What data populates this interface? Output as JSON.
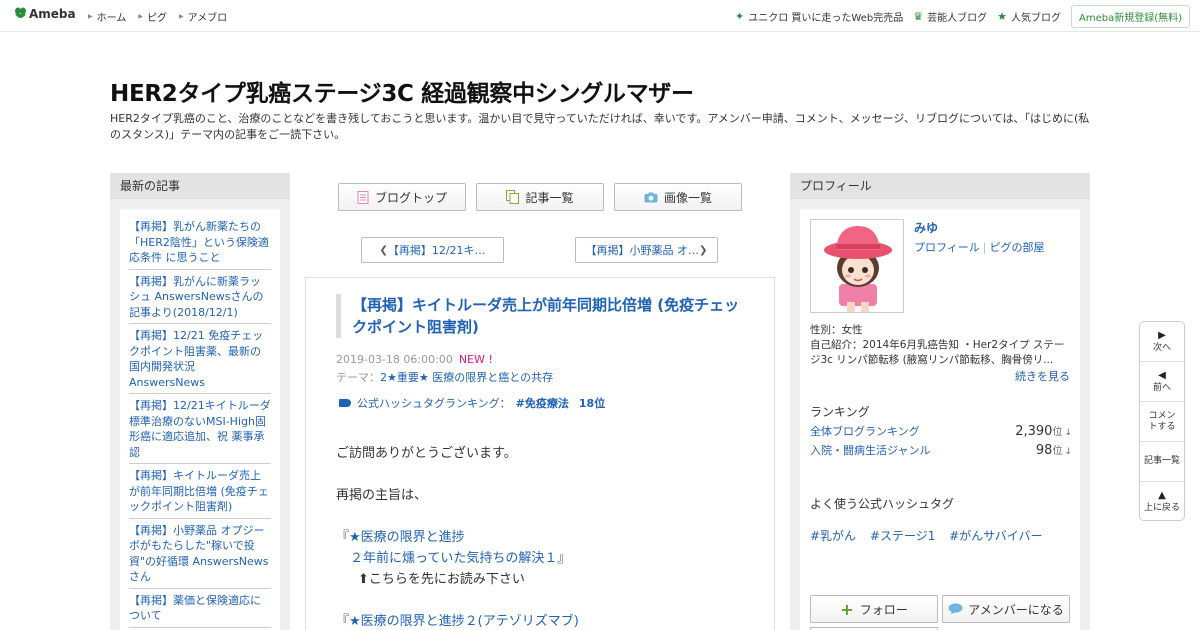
{
  "global_header": {
    "logo": "Ameba",
    "nav": [
      "ホーム",
      "ピグ",
      "アメブロ"
    ],
    "right_links": [
      {
        "label": "ユニクロ 買いに走ったWeb完売品",
        "icon": "sparkle-icon"
      },
      {
        "label": "芸能人ブログ",
        "icon": "crown-icon"
      },
      {
        "label": "人気ブログ",
        "icon": "star-icon"
      }
    ],
    "signup": "Ameba新規登録(無料)"
  },
  "blog": {
    "title": "HER2タイプ乳癌ステージ3C 経過観察中シングルマザー",
    "description": "HER2タイプ乳癌のこと、治療のことなどを書き残しておこうと思います。温かい目で見守っていただければ、幸いです。アメンバー申請、コメント、メッセージ、リブログについては、「はじめに(私のスタンス)」テーマ内の記事をご一読下さい。"
  },
  "left_sidebar": {
    "heading": "最新の記事",
    "items": [
      "【再掲】乳がん新薬たちの「HER2陰性」という保険適応条件 に思うこと",
      "【再掲】乳がんに新薬ラッシュ AnswersNewsさんの記事より(2018/12/1)",
      "【再掲】12/21 免疫チェックポイント阻害薬、最新の国内開発状況 AnswersNews",
      "【再掲】12/21キイトルーダ標準治療のないMSI-High固形癌に適応追加、祝 薬事承認",
      "【再掲】キイトルーダ売上が前年同期比倍増 (免疫チェックポイント阻害剤)",
      "【再掲】小野薬品 オプジーボがもたらした\"稼いで投資\"の好循環 AnswersNewsさん",
      "【再掲】薬価と保険適応について"
    ]
  },
  "toolbar": {
    "blog_top": "ブログトップ",
    "entry_list": "記事一覧",
    "image_list": "画像一覧"
  },
  "pager": {
    "prev": "【再掲】12/21キ…",
    "next": "【再掲】小野薬品 オ…"
  },
  "article": {
    "title": "【再掲】キイトルーダ売上が前年同期比倍増 (免疫チェックポイント阻害剤)",
    "date": "2019-03-18 06:00:00",
    "new_badge": "NEW !",
    "theme_label": "テーマ：",
    "theme": "2★重要★ 医療の限界と癌との共存",
    "hashtag_label": "公式ハッシュタグランキング：",
    "hashtag": "#免疫療法",
    "hashtag_rank": "18位",
    "body": {
      "line1": "ご訪問ありがとうございます。",
      "line2": "再掲の主旨は、",
      "link1_open": "『",
      "link1_a": "★医療の限界と進捗",
      "link1_b": "２年前に燻っていた気持ちの解決１",
      "link1_close": "』",
      "note": "⬆︎こちらを先にお読み下さい",
      "link2_open": "『",
      "link2": "★医療の限界と進捗２(アテゾリズマブ)"
    }
  },
  "profile": {
    "heading": "プロフィール",
    "name": "みゆ",
    "link_profile": "プロフィール",
    "link_room": "ピグの部屋",
    "gender": "性別：女性",
    "intro": "自己紹介：2014年6月乳癌告知 ・Her2タイプ ステージ3c リンパ節転移 (腋窩リンパ節転移、胸骨傍リ...",
    "more": "続きを見る",
    "ranking_heading": "ランキング",
    "rankings": [
      {
        "label": "全体ブログランキング",
        "value": "2,390",
        "unit": "位",
        "trend": "↓"
      },
      {
        "label": "入院・闘病生活ジャンル",
        "value": "98",
        "unit": "位",
        "trend": "↓"
      }
    ],
    "hashtag_heading": "よく使う公式ハッシュタグ",
    "hashtags": [
      "#乳がん",
      "#ステージ1",
      "#がんサバイバー"
    ],
    "follow": "フォロー",
    "amember": "アメンバーになる"
  },
  "floating_nav": {
    "next": "次へ",
    "prev": "前へ",
    "comment": "コメントする",
    "list": "記事一覧",
    "top": "上に戻る"
  },
  "colors": {
    "link": "#2163b3",
    "ameba_green": "#2d8c3c",
    "new_badge": "#e0157a",
    "sidebar_bg": "#eeeeee"
  }
}
